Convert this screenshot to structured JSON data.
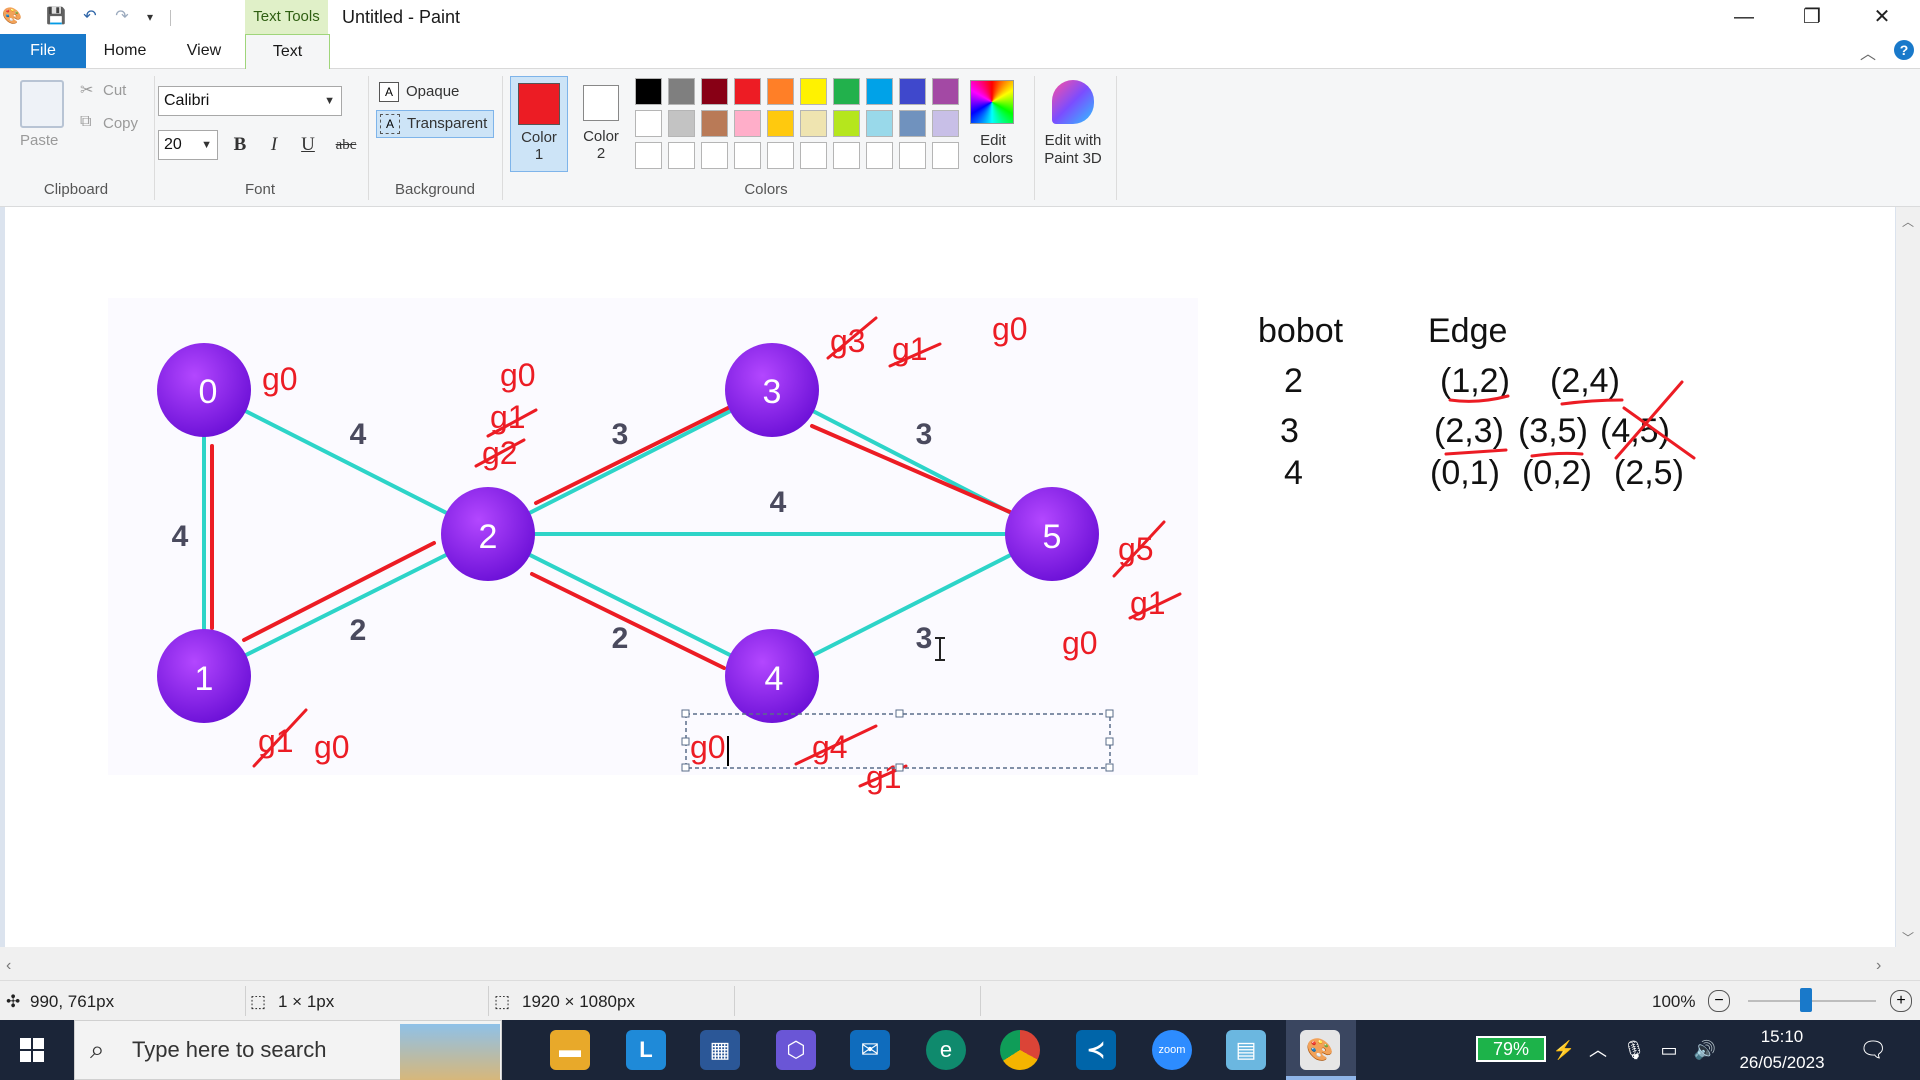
{
  "titlebar": {
    "contextual_tab": "Text Tools",
    "title": "Untitled - Paint",
    "minimize": "—",
    "restore": "❐",
    "close": "✕"
  },
  "tabs": {
    "file": "File",
    "home": "Home",
    "view": "View",
    "text": "Text"
  },
  "ribbon": {
    "clipboard": {
      "paste": "Paste",
      "cut": "Cut",
      "copy": "Copy",
      "label": "Clipboard"
    },
    "font": {
      "family": "Calibri",
      "size": "20",
      "bold": "B",
      "italic": "I",
      "underline": "U",
      "strike": "abc",
      "label": "Font"
    },
    "background": {
      "opaque": "Opaque",
      "transparent": "Transparent",
      "label": "Background"
    },
    "color1": {
      "line1": "Color",
      "line2": "1",
      "value": "#ec1c24"
    },
    "color2": {
      "line1": "Color",
      "line2": "2",
      "value": "#ffffff"
    },
    "colors_label": "Colors",
    "edit_colors": {
      "line1": "Edit",
      "line2": "colors"
    },
    "paint3d": {
      "line1": "Edit with",
      "line2": "Paint 3D"
    },
    "palette_row1": [
      "#000000",
      "#7f7f7f",
      "#880015",
      "#ed1c24",
      "#ff7f27",
      "#fff200",
      "#22b14c",
      "#00a2e8",
      "#3f48cc",
      "#a349a4"
    ],
    "palette_row2": [
      "#ffffff",
      "#c3c3c3",
      "#b97a57",
      "#ffaec9",
      "#ffc90e",
      "#efe4b0",
      "#b5e61d",
      "#99d9ea",
      "#7092be",
      "#c8bfe7"
    ]
  },
  "graph": {
    "nodes": [
      {
        "label": "0"
      },
      {
        "label": "1"
      },
      {
        "label": "2"
      },
      {
        "label": "3"
      },
      {
        "label": "4"
      },
      {
        "label": "5"
      }
    ],
    "weights": {
      "w01": "4",
      "w02": "4",
      "w12": "2",
      "w23": "3",
      "w24": "2",
      "w25": "4",
      "w35": "3",
      "w45": "3"
    },
    "annotations": {
      "n0_g0": "g0",
      "n2_g0": "g0",
      "n2_g1": "g1",
      "n2_g2": "g2",
      "n3_g3": "g3",
      "n3_g1": "g1",
      "n3_g0": "g0",
      "n5_g5": "g5",
      "n5_g1": "g1",
      "n5_g0": "g0",
      "n1_g1": "g1",
      "n1_g0": "g0",
      "n4_g0": "g0",
      "n4_g4": "g4",
      "n4_g1": "g1"
    }
  },
  "table": {
    "header_weight": "bobot",
    "header_edge": "Edge",
    "rows": [
      {
        "weight": "2",
        "e1": "(1,2)",
        "e2": "(2,4)"
      },
      {
        "weight": "3",
        "e1": "(2,3)",
        "e2": "(3,5)",
        "e3": "(4,5)"
      },
      {
        "weight": "4",
        "e1": "(0,1)",
        "e2": "(0,2)",
        "e3": "(2,5)"
      }
    ]
  },
  "status": {
    "cursor": "990, 761px",
    "selection": "1 × 1px",
    "size": "1920 × 1080px",
    "zoom": "100%"
  },
  "taskbar": {
    "search_placeholder": "Type here to search",
    "battery": "79%",
    "time": "15:10",
    "date": "26/05/2023"
  }
}
